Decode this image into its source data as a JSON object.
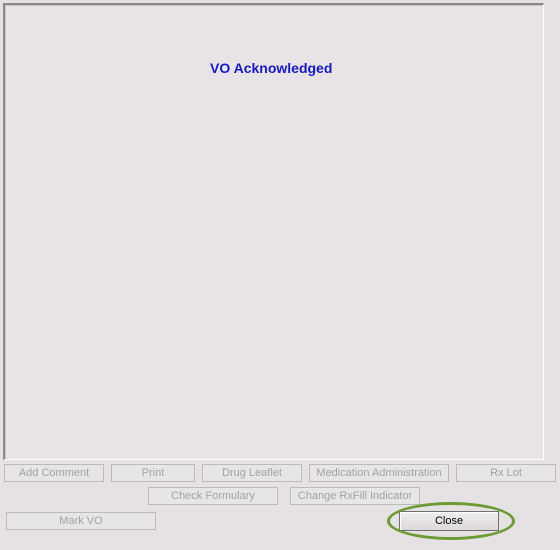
{
  "panel": {
    "title": "VO Acknowledged"
  },
  "buttons": {
    "add_comment": "Add Comment",
    "print": "Print",
    "drug_leaflet": "Drug Leaflet",
    "medication_administration": "Medication Administration",
    "rx_lot": "Rx Lot",
    "check_formulary": "Check Formulary",
    "change_rxfill_indicator": "Change RxFill Indicator",
    "mark_vo": "Mark VO",
    "close": "Close"
  },
  "colors": {
    "title": "#1818c8",
    "highlight_ring": "#6d9b33",
    "background": "#e6e2e4"
  }
}
